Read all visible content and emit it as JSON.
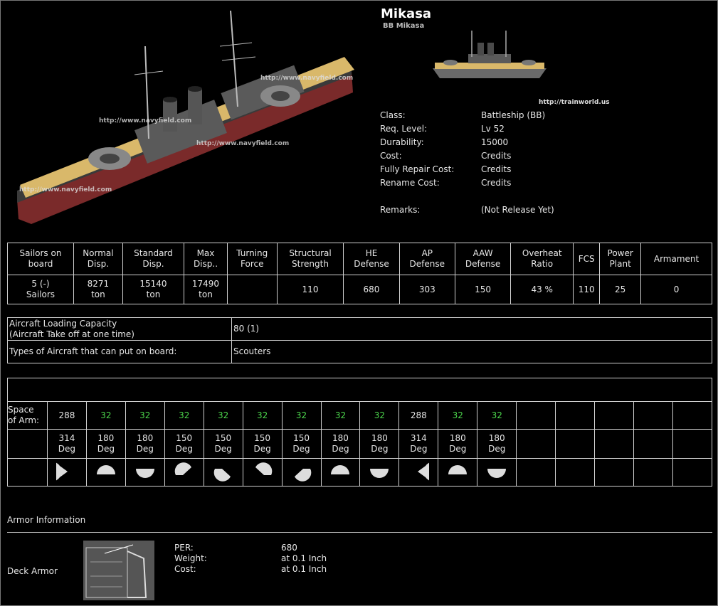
{
  "ship": {
    "name": "Mikasa",
    "subtitle": "BB Mikasa",
    "source_link": "http://trainworld.us",
    "watermark": "http://www.navyfield.com"
  },
  "info": [
    {
      "key": "Class:",
      "value": "Battleship (BB)"
    },
    {
      "key": "Req. Level:",
      "value": "Lv 52"
    },
    {
      "key": "Durability:",
      "value": "15000"
    },
    {
      "key": "Cost:",
      "value": "Credits"
    },
    {
      "key": "Fully Repair Cost:",
      "value": "Credits"
    },
    {
      "key": "Rename Cost:",
      "value": "Credits"
    },
    {
      "key": "",
      "value": ""
    },
    {
      "key": "Remarks:",
      "value": "(Not Release Yet)"
    }
  ],
  "stats": {
    "headers": [
      [
        "Sailors on",
        "board"
      ],
      [
        "Normal",
        "Disp."
      ],
      [
        "Standard",
        "Disp."
      ],
      [
        "Max",
        "Disp.."
      ],
      [
        "Turning",
        "Force"
      ],
      [
        "Structural",
        "Strength"
      ],
      [
        "HE",
        "Defense"
      ],
      [
        "AP",
        "Defense"
      ],
      [
        "AAW",
        "Defense"
      ],
      [
        "Overheat",
        "Ratio"
      ],
      [
        "FCS"
      ],
      [
        "Power",
        "Plant"
      ],
      [
        "Armament"
      ]
    ],
    "values": [
      [
        "5 (-)",
        "Sailors"
      ],
      [
        "8271",
        "ton"
      ],
      [
        "15140",
        "ton"
      ],
      [
        "17490",
        "ton"
      ],
      [
        ""
      ],
      [
        "110"
      ],
      [
        "680"
      ],
      [
        "303"
      ],
      [
        "150"
      ],
      [
        "43 %"
      ],
      [
        "110"
      ],
      [
        "25"
      ],
      [
        "0"
      ]
    ]
  },
  "aircraft": {
    "capacity_label_1": "Aircraft Loading Capacity",
    "capacity_label_2": "(Aircraft Take off at one time)",
    "capacity_value": "80 (1)",
    "types_label": "Types of Aircraft that can put on board:",
    "types_value": "Scouters"
  },
  "armament": {
    "space_label_1": "Space",
    "space_label_2": "of Arm:",
    "slots": [
      {
        "space": "288",
        "green": false,
        "deg": "314",
        "unit": "Deg",
        "arc": "pac-left"
      },
      {
        "space": "32",
        "green": true,
        "deg": "180",
        "unit": "Deg",
        "arc": "top"
      },
      {
        "space": "32",
        "green": true,
        "deg": "180",
        "unit": "Deg",
        "arc": "bottom"
      },
      {
        "space": "32",
        "green": true,
        "deg": "150",
        "unit": "Deg",
        "arc": "top-left"
      },
      {
        "space": "32",
        "green": true,
        "deg": "150",
        "unit": "Deg",
        "arc": "bottom-left"
      },
      {
        "space": "32",
        "green": true,
        "deg": "150",
        "unit": "Deg",
        "arc": "top-right"
      },
      {
        "space": "32",
        "green": true,
        "deg": "150",
        "unit": "Deg",
        "arc": "bottom-right"
      },
      {
        "space": "32",
        "green": true,
        "deg": "180",
        "unit": "Deg",
        "arc": "top"
      },
      {
        "space": "32",
        "green": true,
        "deg": "180",
        "unit": "Deg",
        "arc": "bottom"
      },
      {
        "space": "288",
        "green": false,
        "deg": "314",
        "unit": "Deg",
        "arc": "pac-right"
      },
      {
        "space": "32",
        "green": true,
        "deg": "180",
        "unit": "Deg",
        "arc": "top"
      },
      {
        "space": "32",
        "green": true,
        "deg": "180",
        "unit": "Deg",
        "arc": "bottom"
      }
    ],
    "empty_slots": 5
  },
  "armor": {
    "heading": "Armor Information",
    "deck_label": "Deck Armor",
    "rows": [
      {
        "key": "PER:",
        "value": "680"
      },
      {
        "key": "Weight:",
        "value": "at 0.1 Inch"
      },
      {
        "key": "Cost:",
        "value": "at 0.1 Inch"
      }
    ]
  },
  "colors": {
    "background": "#000000",
    "text": "#e6e6e6",
    "green": "#4cd64c",
    "deck": "#d9b86a",
    "hull": "#8a2c2c"
  }
}
